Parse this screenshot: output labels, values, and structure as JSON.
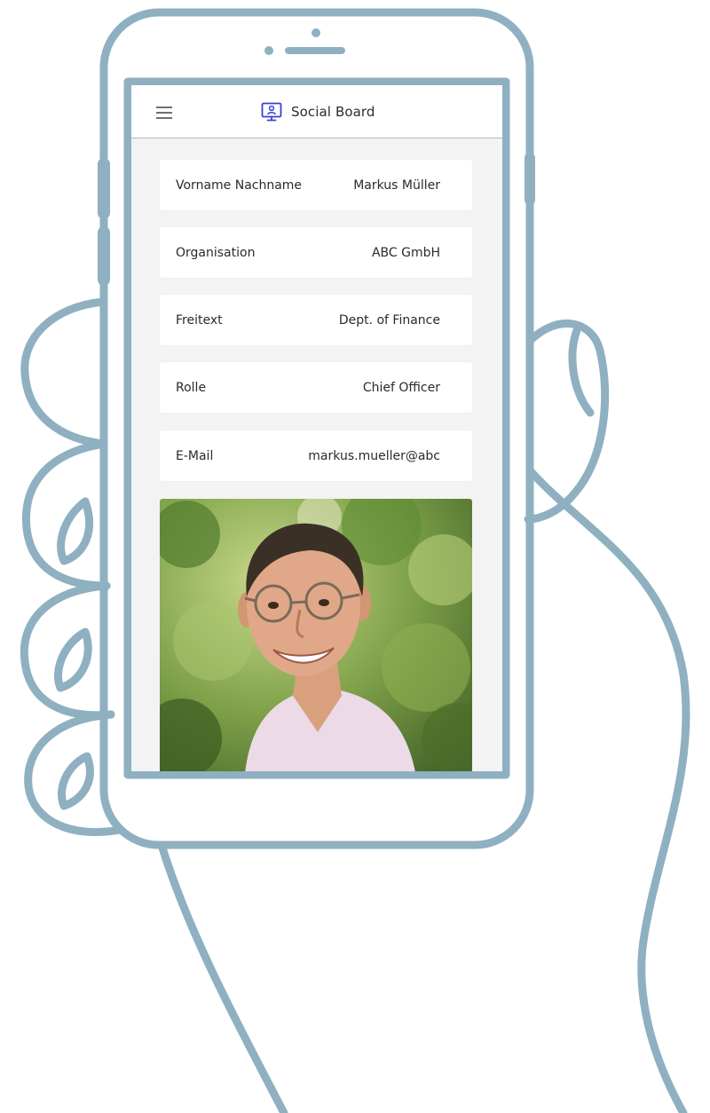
{
  "app": {
    "title": "Social Board",
    "menu_icon": "hamburger-menu-icon",
    "brand_icon": "monitor-user-icon",
    "accent_color": "#3b3fd6"
  },
  "profile": {
    "fields": [
      {
        "label": "Vorname Nachname",
        "value": "Markus Müller"
      },
      {
        "label": "Organisation",
        "value": "ABC GmbH"
      },
      {
        "label": "Freitext",
        "value": "Dept. of Finance"
      },
      {
        "label": "Rolle",
        "value": "Chief Officer"
      },
      {
        "label": "E-Mail",
        "value": "markus.mueller@abc"
      }
    ]
  },
  "illustration": {
    "line_color": "#8fb0c1"
  }
}
